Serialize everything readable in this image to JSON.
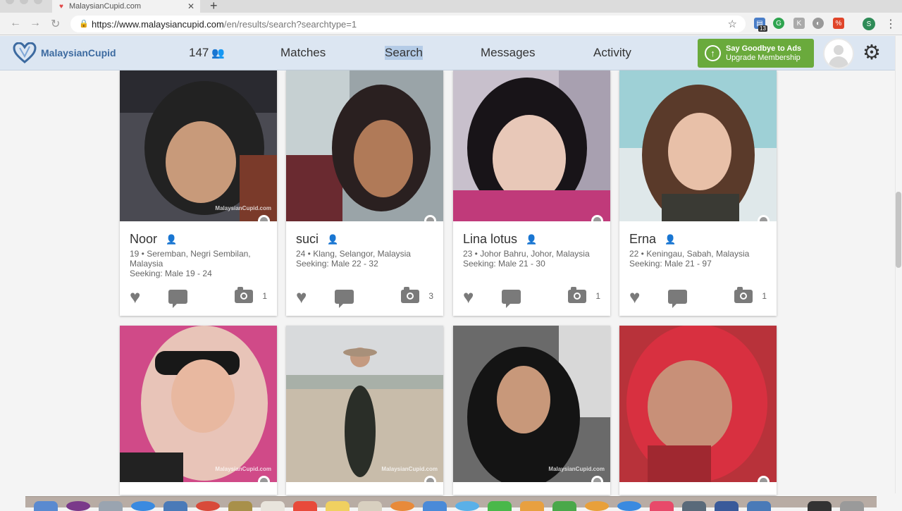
{
  "browser": {
    "tab_title": "MalaysianCupid.com",
    "url_host": "https://www.malaysiancupid.com",
    "url_path": "/en/results/search?searchtype=1",
    "extension_badge": "13",
    "profile_letter": "S"
  },
  "site": {
    "brand": "MalaysianCupid",
    "counter": "147",
    "nav": [
      "Matches",
      "Search",
      "Messages",
      "Activity"
    ],
    "active_nav": "Search",
    "upgrade_line1": "Say Goodbye to Ads",
    "upgrade_line2": "Upgrade Membership",
    "colors": {
      "header_bg": "#dce6f2",
      "brand_blue": "#3c6aa0",
      "upgrade_green": "#6aaa3c"
    }
  },
  "profiles": [
    {
      "name": "Noor",
      "details": "19 • Seremban, Negri Sembilan, Malaysia",
      "seeking": "Seeking: Male 19 - 24",
      "photos": "1"
    },
    {
      "name": "suci",
      "details": "24 • Klang, Selangor, Malaysia",
      "seeking": "Seeking: Male 22 - 32",
      "photos": "3"
    },
    {
      "name": "Lina lotus",
      "details": "23 • Johor Bahru, Johor, Malaysia",
      "seeking": "Seeking: Male 21 - 30",
      "photos": "1"
    },
    {
      "name": "Erna",
      "details": "22 • Keningau, Sabah, Malaysia",
      "seeking": "Seeking: Male 21 - 97",
      "photos": "1"
    }
  ],
  "watermark": "MalaysianCupid.com"
}
